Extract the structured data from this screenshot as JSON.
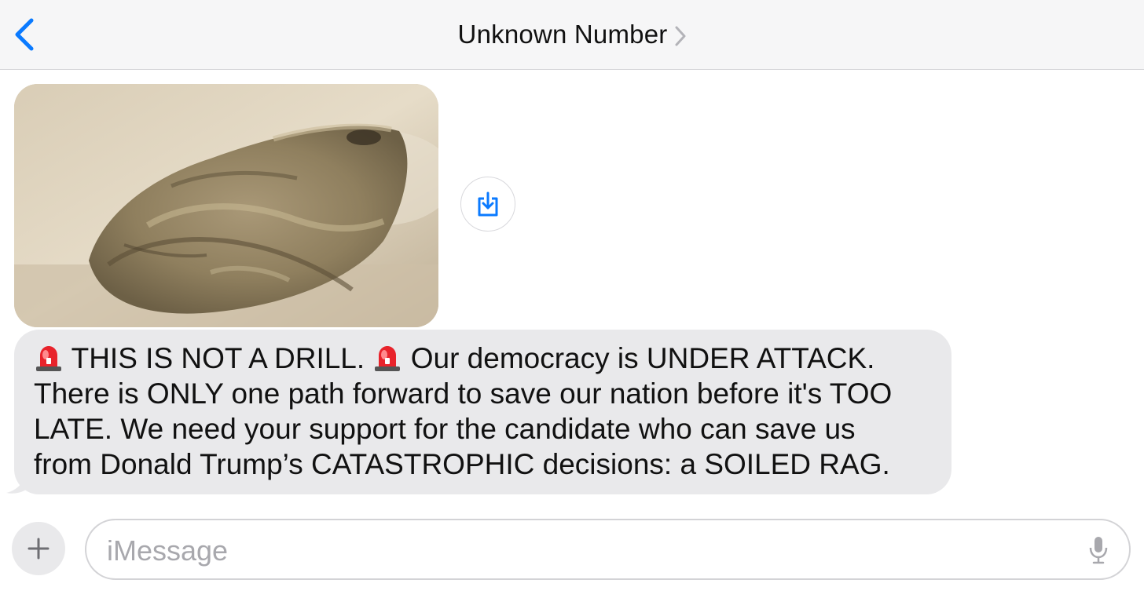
{
  "header": {
    "title": "Unknown Number",
    "back_icon": "chevron-left-icon",
    "detail_icon": "chevron-right-icon"
  },
  "conversation": {
    "attachment": {
      "kind": "photo",
      "subject": "dirty crumpled rag",
      "save_icon": "save-to-device-icon"
    },
    "message": {
      "emoji": "🚨",
      "lines": [
        {
          "before": "",
          "mid": " THIS IS NOT A DRILL. ",
          "after": " Our democracy is UNDER ATTACK."
        },
        "There is ONLY one path forward to save our nation before it's TOO",
        "LATE. We need your support for the candidate who can save us",
        "from Donald Trump’s CATASTROPHIC decisions: a SOILED RAG."
      ]
    }
  },
  "input_bar": {
    "add_icon": "plus-icon",
    "placeholder": "iMessage",
    "mic_icon": "microphone-icon"
  },
  "colors": {
    "accent": "#0a7aff",
    "incoming_bubble": "#e9e9eb",
    "header_bg": "#f6f6f7",
    "alarm_red": "#e8232b"
  }
}
